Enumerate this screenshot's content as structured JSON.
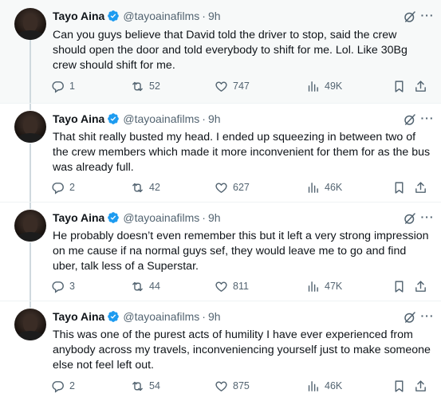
{
  "colors": {
    "verified": "#1d9bf0",
    "icon_gray": "#536471",
    "text": "#0f1419",
    "highlight_bg": "#f7f9f9"
  },
  "tweets": [
    {
      "name": "Tayo Aina",
      "handle": "@tayoainafilms",
      "separator": "·",
      "time": "9h",
      "text": "Can you guys believe that David told the driver to stop, said the crew should open the door and told everybody to shift for me. Lol. Like 30Bg crew should shift for me.",
      "replies": "1",
      "reposts": "52",
      "likes": "747",
      "views": "49K"
    },
    {
      "name": "Tayo Aina",
      "handle": "@tayoainafilms",
      "separator": "·",
      "time": "9h",
      "text": "That shit really busted my head. I ended up squeezing in between two of the crew members which made it more inconvenient for them for as the bus was already full.",
      "replies": "2",
      "reposts": "42",
      "likes": "627",
      "views": "46K"
    },
    {
      "name": "Tayo Aina",
      "handle": "@tayoainafilms",
      "separator": "·",
      "time": "9h",
      "text": "He probably doesn’t even remember this but it left a very strong impression on me cause if na normal guys sef, they would leave me to go and find uber, talk less of a Superstar.",
      "replies": "3",
      "reposts": "44",
      "likes": "811",
      "views": "47K"
    },
    {
      "name": "Tayo Aina",
      "handle": "@tayoainafilms",
      "separator": "·",
      "time": "9h",
      "text": "This was one of the purest acts of humility I have ever experienced from anybody across my travels, inconveniencing yourself just to make someone else not feel left out.",
      "replies": "2",
      "reposts": "54",
      "likes": "875",
      "views": "46K"
    }
  ]
}
